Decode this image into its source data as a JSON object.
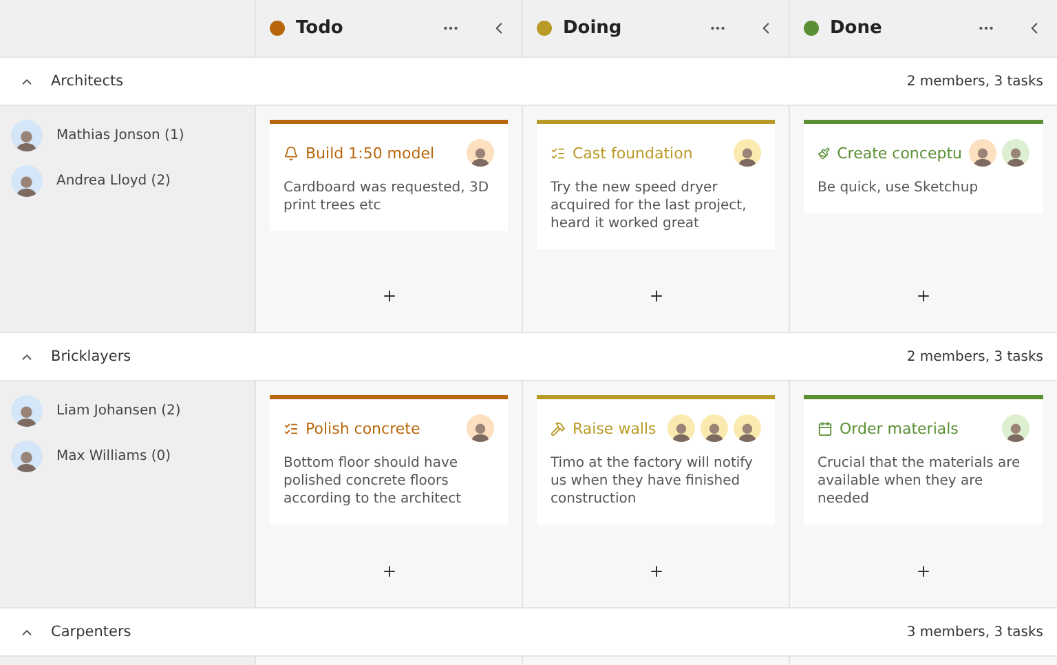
{
  "columns": [
    {
      "title": "Todo",
      "color": "#b8660b"
    },
    {
      "title": "Doing",
      "color": "#b89a26"
    },
    {
      "title": "Done",
      "color": "#5a8f33"
    }
  ],
  "lanes": [
    {
      "name": "Architects",
      "summary": "2 members, 3 tasks",
      "expanded": true,
      "members": [
        {
          "name": "Mathias Jonson (1)",
          "color": "#d4e6f7"
        },
        {
          "name": "Andrea Lloyd (2)",
          "color": "#d4e6f7"
        }
      ],
      "cards": [
        {
          "kind": "bell",
          "title": "Build 1:50 model",
          "text": "Cardboard was requested, 3D print trees etc",
          "assignees": [
            {
              "color": "#fde0c0"
            }
          ]
        },
        {
          "kind": "checklist",
          "title": "Cast foundation",
          "text": "Try the new speed dryer acquired for the last project, heard it worked great",
          "assignees": [
            {
              "color": "#fbeab0"
            }
          ]
        },
        {
          "kind": "brush",
          "title": "Create conceptu",
          "text": "Be quick, use Sketchup",
          "assignees": [
            {
              "color": "#fde0c0"
            },
            {
              "color": "#dcefd0"
            }
          ]
        }
      ]
    },
    {
      "name": "Bricklayers",
      "summary": "2 members, 3 tasks",
      "expanded": true,
      "members": [
        {
          "name": "Liam Johansen (2)",
          "color": "#d4e6f7"
        },
        {
          "name": "Max Williams (0)",
          "color": "#d4e6f7"
        }
      ],
      "cards": [
        {
          "kind": "checklist",
          "title": "Polish concrete",
          "text": "Bottom floor should have polished concrete floors according to the architect",
          "assignees": [
            {
              "color": "#fde0c0"
            }
          ]
        },
        {
          "kind": "hammer",
          "title": "Raise walls",
          "text": "Timo at the factory will notify us when they have finished construction",
          "assignees": [
            {
              "color": "#fbeab0"
            },
            {
              "color": "#fbeab0"
            },
            {
              "color": "#fbeab0"
            }
          ]
        },
        {
          "kind": "calendar",
          "title": "Order materials",
          "text": "Crucial that the materials are available when they are needed",
          "assignees": [
            {
              "color": "#dcefd0"
            }
          ]
        }
      ]
    },
    {
      "name": "Carpenters",
      "summary": "3 members, 3 tasks",
      "expanded": true
    }
  ]
}
